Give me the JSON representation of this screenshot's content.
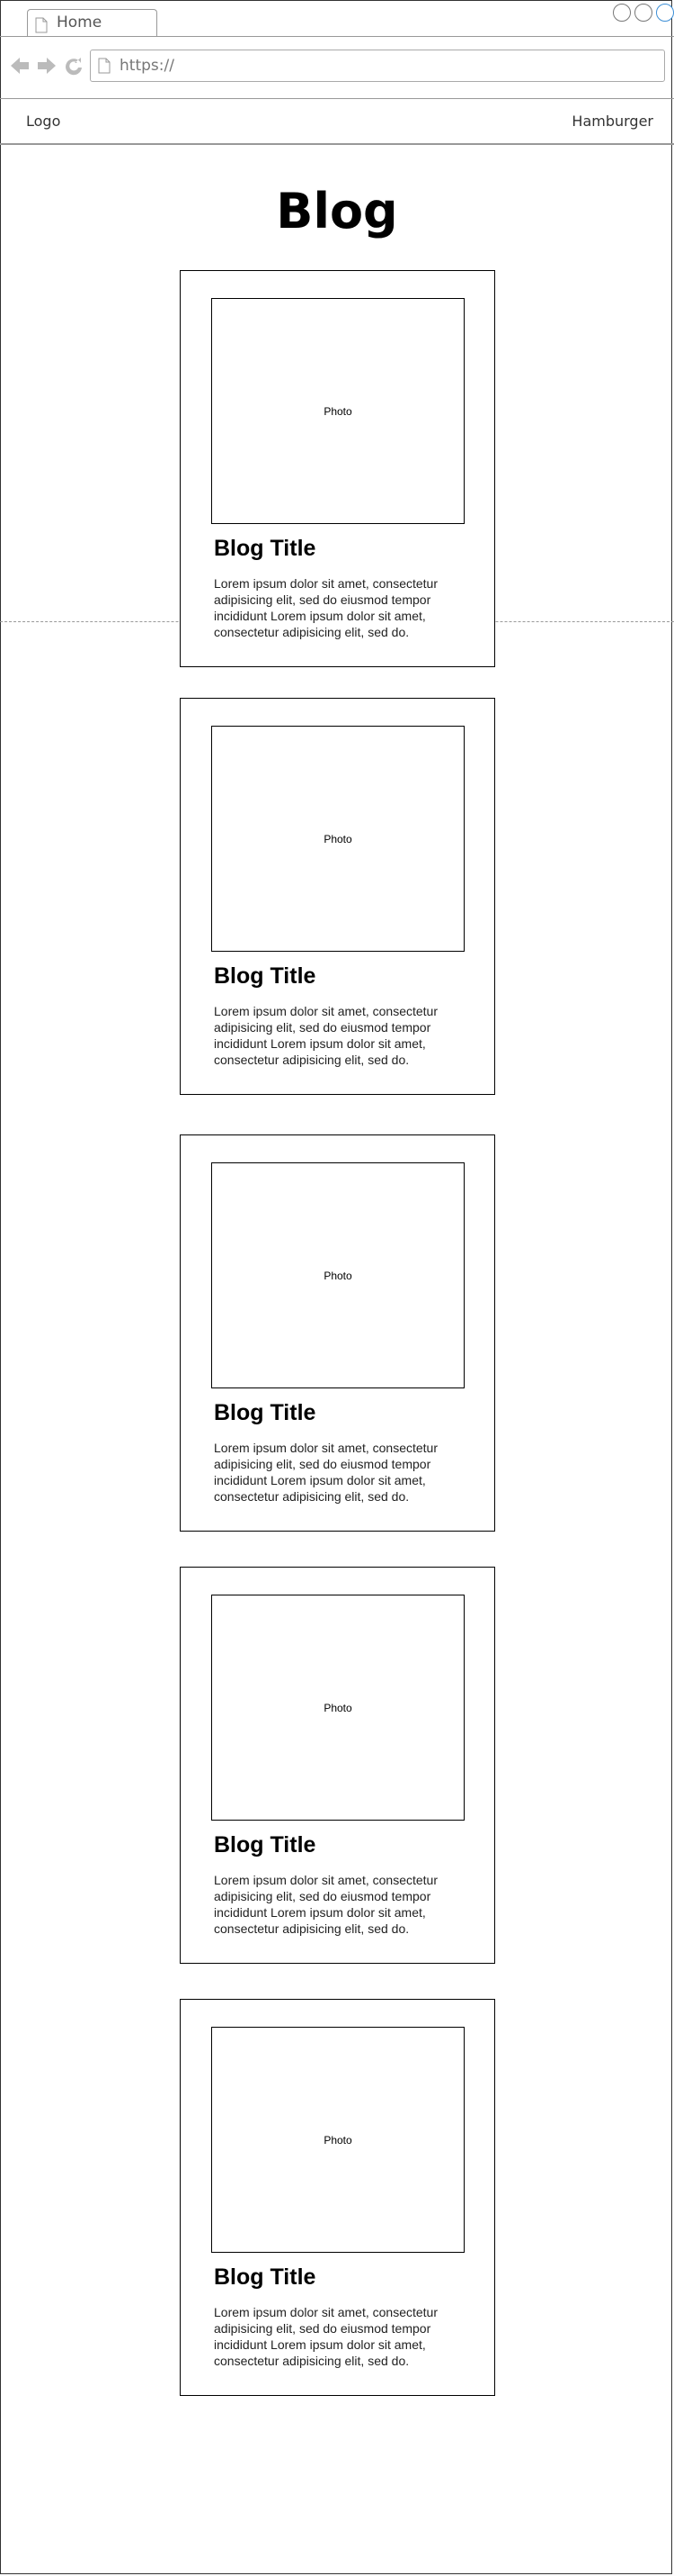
{
  "browser": {
    "tab_label": "Home",
    "url": "https://"
  },
  "header": {
    "logo": "Logo",
    "menu": "Hamburger"
  },
  "page": {
    "title": "Blog"
  },
  "posts": [
    {
      "photo": "Photo",
      "title": "Blog Title",
      "excerpt": "Lorem ipsum dolor sit amet, consectetur adipisicing elit, sed do eiusmod tempor incididunt Lorem ipsum dolor sit amet, consectetur adipisicing elit, sed do."
    },
    {
      "photo": "Photo",
      "title": "Blog Title",
      "excerpt": "Lorem ipsum dolor sit amet, consectetur adipisicing elit, sed do eiusmod tempor incididunt Lorem ipsum dolor sit amet, consectetur adipisicing elit, sed do."
    },
    {
      "photo": "Photo",
      "title": "Blog Title",
      "excerpt": "Lorem ipsum dolor sit amet, consectetur adipisicing elit, sed do eiusmod tempor incididunt Lorem ipsum dolor sit amet, consectetur adipisicing elit, sed do."
    },
    {
      "photo": "Photo",
      "title": "Blog Title",
      "excerpt": "Lorem ipsum dolor sit amet, consectetur adipisicing elit, sed do eiusmod tempor incididunt Lorem ipsum dolor sit amet, consectetur adipisicing elit, sed do."
    },
    {
      "photo": "Photo",
      "title": "Blog Title",
      "excerpt": "Lorem ipsum dolor sit amet, consectetur adipisicing elit, sed do eiusmod tempor incididunt Lorem ipsum dolor sit amet, consectetur adipisicing elit, sed do."
    }
  ],
  "icons": {
    "back": "arrow-left-icon",
    "forward": "arrow-right-icon",
    "reload": "reload-icon",
    "page": "page-icon"
  },
  "colors": {
    "window_control_accent": "#3d8fd6",
    "chrome_gray": "#bbbbbb"
  }
}
